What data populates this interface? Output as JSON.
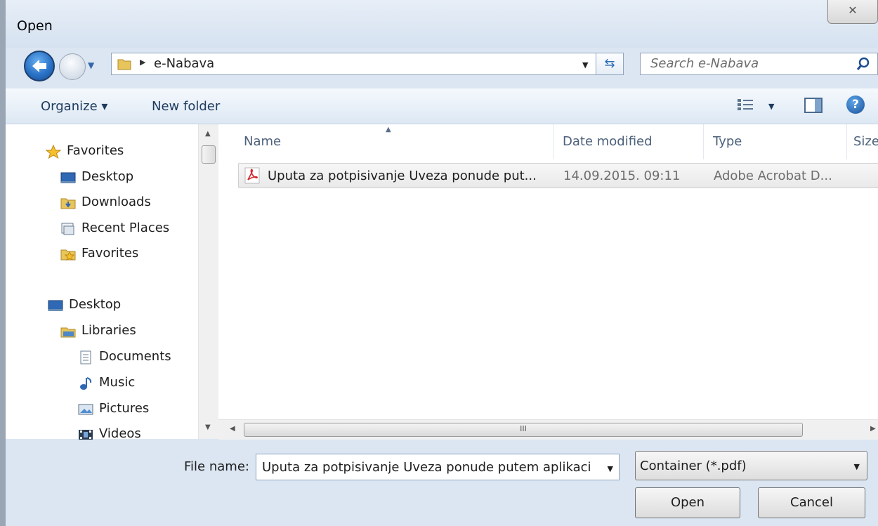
{
  "window": {
    "title": "Open",
    "close_glyph": "✕"
  },
  "address": {
    "path": "e-Nabava",
    "search_placeholder": "Search e-Nabava"
  },
  "toolbar": {
    "organize": "Organize ▾",
    "new_folder": "New folder",
    "help": "?"
  },
  "nav": {
    "items": [
      {
        "label": "Favorites",
        "icon": "star-icon"
      },
      {
        "label": "Desktop",
        "icon": "desktop-icon"
      },
      {
        "label": "Downloads",
        "icon": "downloads-folder-icon"
      },
      {
        "label": "Recent Places",
        "icon": "recent-places-icon"
      },
      {
        "label": "Favorites",
        "icon": "favorites-folder-icon"
      },
      {
        "label": "Desktop",
        "icon": "desktop-icon"
      },
      {
        "label": "Libraries",
        "icon": "libraries-icon"
      },
      {
        "label": "Documents",
        "icon": "document-icon"
      },
      {
        "label": "Music",
        "icon": "music-icon"
      },
      {
        "label": "Pictures",
        "icon": "pictures-icon"
      },
      {
        "label": "Videos",
        "icon": "videos-icon"
      }
    ]
  },
  "files": {
    "columns": [
      "Name",
      "Date modified",
      "Type",
      "Size"
    ],
    "rows": [
      {
        "name": "Uputa za potpisivanje Uveza ponude put...",
        "date": "14.09.2015. 09:11",
        "type": "Adobe Acrobat D..."
      }
    ],
    "scroll_grip": "III"
  },
  "bottom": {
    "file_name_label": "File name:",
    "file_name_value": "Uputa za potpisivanje Uveza ponude putem aplikaci",
    "filter_value": "Container (*.pdf)",
    "open_label": "Open",
    "cancel_label": "Cancel"
  }
}
